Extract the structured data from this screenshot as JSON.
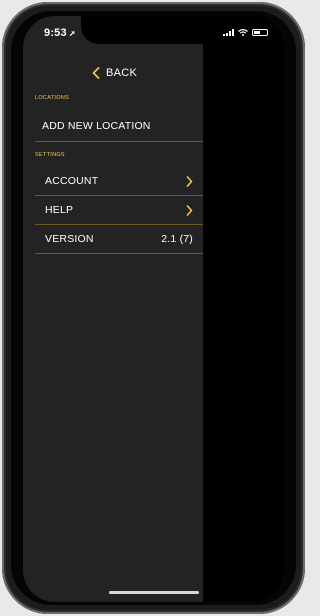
{
  "status_bar": {
    "time": "9:53",
    "location_arrow": "➚"
  },
  "header": {
    "back_label": "BACK"
  },
  "locations_section": {
    "title": "LOCATIONS",
    "add_label": "ADD NEW LOCATION"
  },
  "settings_section": {
    "title": "SETTINGS",
    "items": [
      {
        "label": "ACCOUNT"
      },
      {
        "label": "HELP"
      },
      {
        "label": "VERSION",
        "value": "2.1 (7)"
      }
    ]
  },
  "colors": {
    "accent": "#f2c84b",
    "drawer_bg": "#232323",
    "divider": "#6b5a22"
  },
  "icons": {
    "back": "chevron-left-icon",
    "row": "chevron-right-icon"
  }
}
